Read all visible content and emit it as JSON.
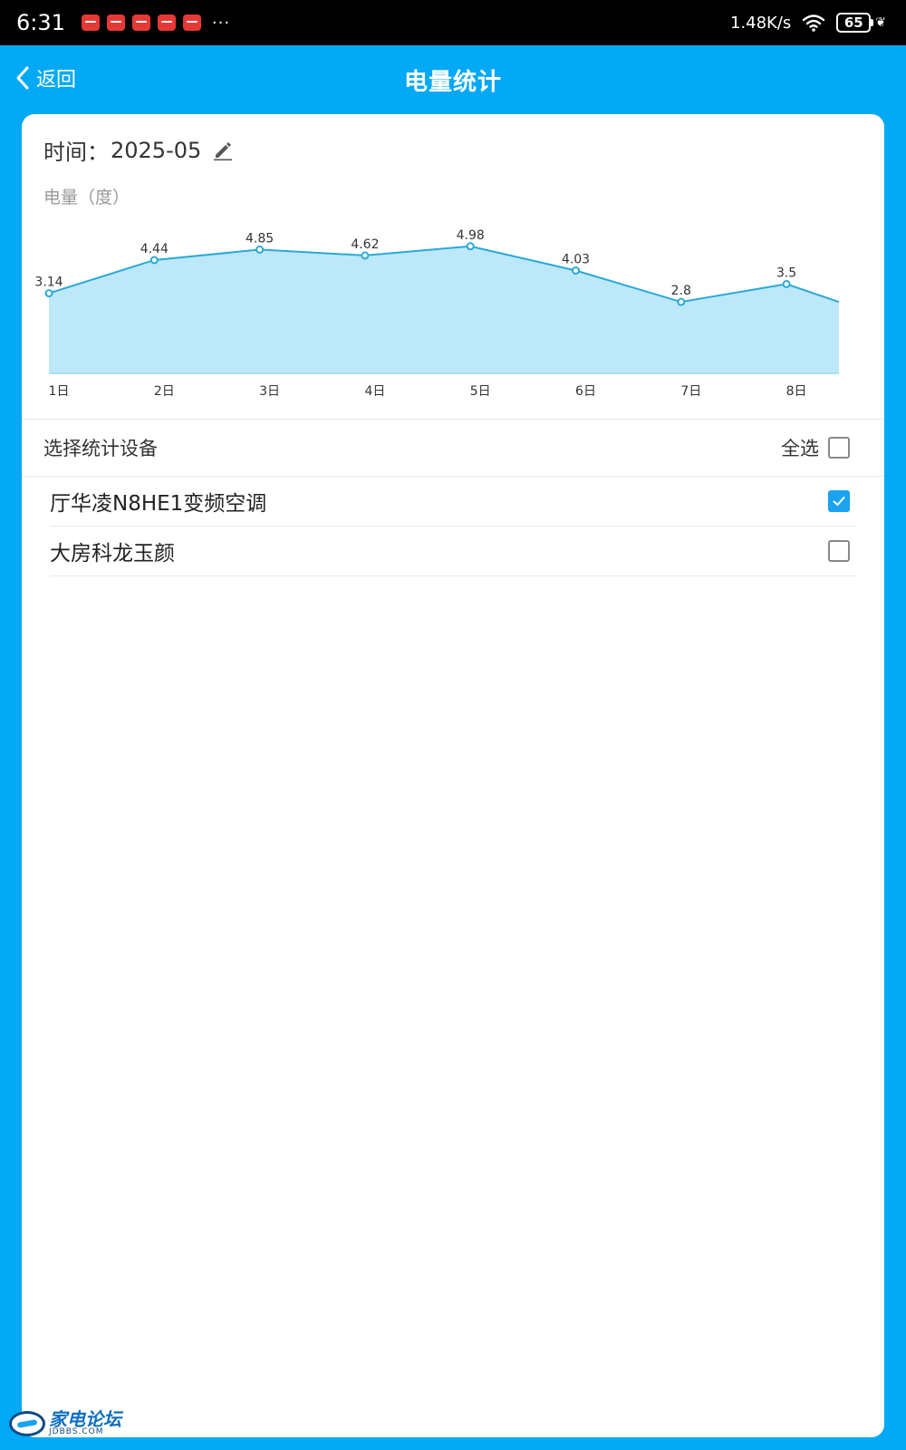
{
  "status_bar": {
    "time": "6:31",
    "more": "···",
    "network_speed": "1.48K/s",
    "battery": "65",
    "notification_icons": [
      "app-notification-icon",
      "app-notification-icon",
      "app-notification-icon",
      "app-notification-icon",
      "app-notification-icon"
    ]
  },
  "nav": {
    "back_label": "返回",
    "title": "电量统计"
  },
  "filter": {
    "time_label": "时间：",
    "time_value": "2025-05"
  },
  "chart_data": {
    "type": "area",
    "ylabel": "电量（度）",
    "categories": [
      "1日",
      "2日",
      "3日",
      "4日",
      "5日",
      "6日",
      "7日",
      "8日"
    ],
    "values": [
      3.14,
      4.44,
      4.85,
      4.62,
      4.98,
      4.03,
      2.8,
      3.5
    ],
    "trailing_value_estimate": 2.8,
    "ylim": [
      0,
      6.25
    ],
    "line_color": "#2aa9d6",
    "fill_color": "#bde8fa",
    "grid": false
  },
  "device_section": {
    "label": "选择统计设备",
    "select_all_label": "全选",
    "select_all_checked": false
  },
  "devices": [
    {
      "name": "厅华凌N8HE1变频空调",
      "checked": true
    },
    {
      "name": "大房科龙玉颜",
      "checked": false
    }
  ],
  "watermark": {
    "main": "家电论坛",
    "sub": "JDBBS.COM"
  },
  "colors": {
    "primary": "#03a9f4",
    "checkbox_checked": "#1aa3f0"
  }
}
